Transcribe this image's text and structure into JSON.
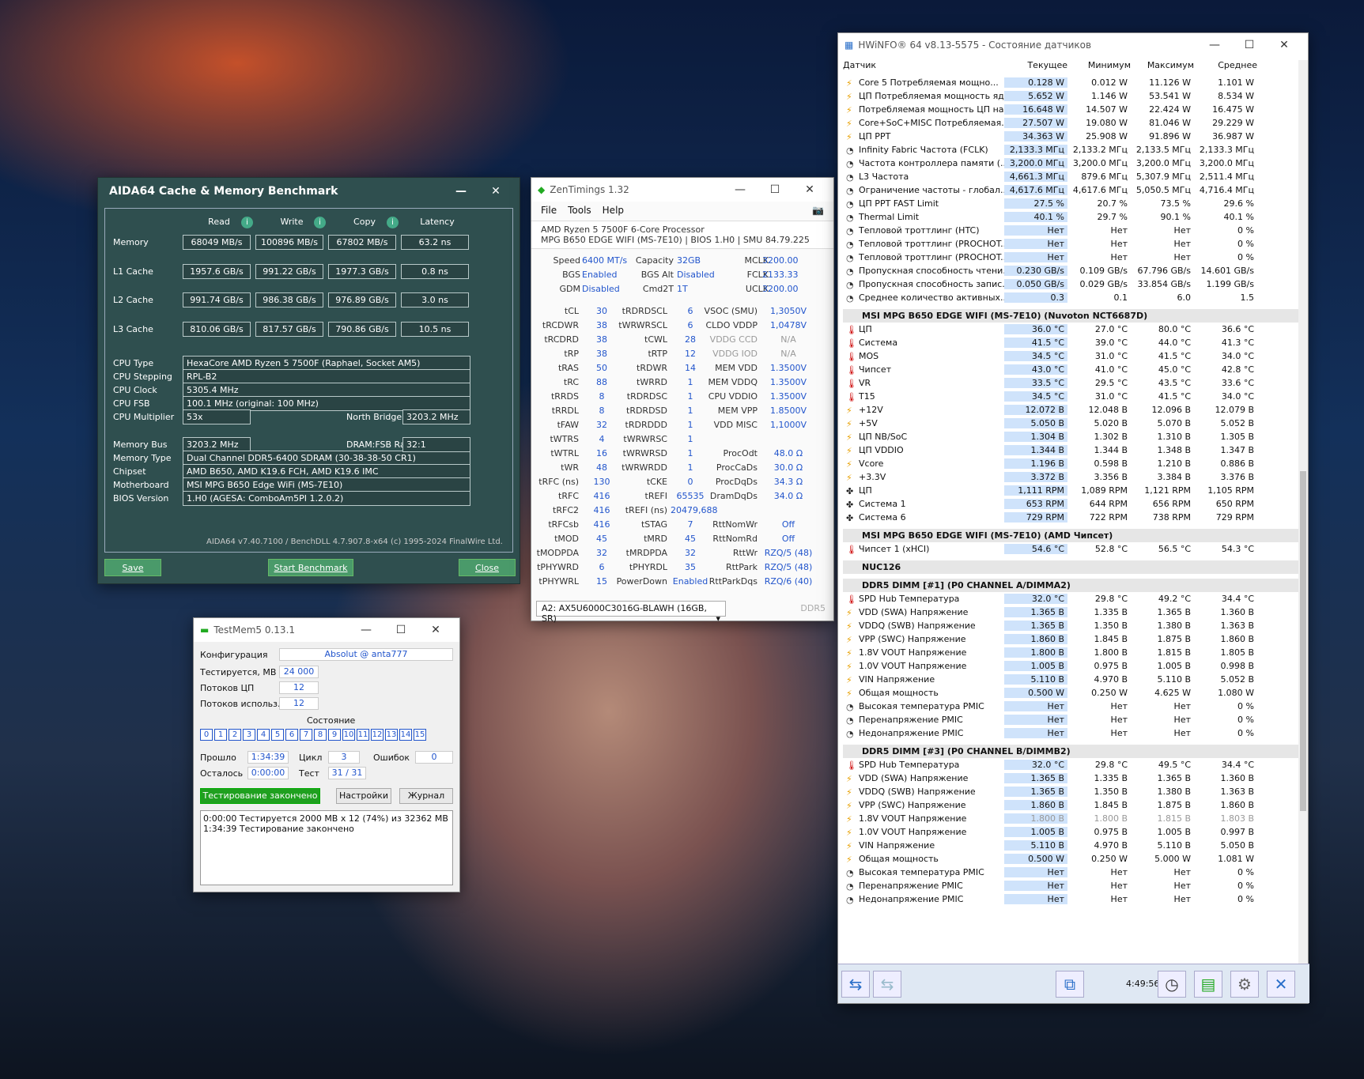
{
  "aida": {
    "title": "AIDA64 Cache & Memory Benchmark",
    "headers": [
      "Read",
      "Write",
      "Copy",
      "Latency"
    ],
    "bench": [
      {
        "label": "Memory",
        "vals": [
          "68049 MB/s",
          "100896 MB/s",
          "67802 MB/s",
          "63.2 ns"
        ]
      },
      {
        "label": "L1 Cache",
        "vals": [
          "1957.6 GB/s",
          "991.22 GB/s",
          "1977.3 GB/s",
          "0.8 ns"
        ]
      },
      {
        "label": "L2 Cache",
        "vals": [
          "991.74 GB/s",
          "986.38 GB/s",
          "976.89 GB/s",
          "3.0 ns"
        ]
      },
      {
        "label": "L3 Cache",
        "vals": [
          "810.06 GB/s",
          "817.57 GB/s",
          "790.86 GB/s",
          "10.5 ns"
        ]
      }
    ],
    "cpu_type_l": "CPU Type",
    "cpu_type": "HexaCore AMD Ryzen 5 7500F  (Raphael, Socket AM5)",
    "cpu_step_l": "CPU Stepping",
    "cpu_step": "RPL-B2",
    "cpu_clock_l": "CPU Clock",
    "cpu_clock": "5305.4 MHz",
    "cpu_fsb_l": "CPU FSB",
    "cpu_fsb": "100.1 MHz  (original: 100 MHz)",
    "cpu_mult_l": "CPU Multiplier",
    "cpu_mult": "53x",
    "nb_l": "North Bridge Clock",
    "nb": "3203.2 MHz",
    "membus_l": "Memory Bus",
    "membus": "3203.2 MHz",
    "ratio_l": "DRAM:FSB Ratio",
    "ratio": "32:1",
    "memtype_l": "Memory Type",
    "memtype": "Dual Channel DDR5-6400 SDRAM  (30-38-38-50 CR1)",
    "chipset_l": "Chipset",
    "chipset": "AMD B650, AMD K19.6 FCH, AMD K19.6 IMC",
    "mb_l": "Motherboard",
    "mb": "MSI MPG B650 Edge WiFi (MS-7E10)",
    "bios_l": "BIOS Version",
    "bios": "1.H0  (AGESA: ComboAm5PI 1.2.0.2)",
    "footer": "AIDA64 v7.40.7100 / BenchDLL 4.7.907.8-x64  (c) 1995-2024 FinalWire Ltd.",
    "save": "Save",
    "start": "Start Benchmark",
    "close": "Close"
  },
  "zen": {
    "title": "ZenTimings 1.32",
    "menu": [
      "File",
      "Tools",
      "Help"
    ],
    "cpu": "AMD Ryzen 5 7500F 6-Core Processor",
    "board": "MPG B650 EDGE WIFI (MS-7E10) | BIOS 1.H0 | SMU 84.79.225",
    "top": [
      [
        "Speed",
        "6400 MT/s",
        "Capacity",
        "32GB",
        "MCLK",
        "3200.00"
      ],
      [
        "BGS",
        "Enabled",
        "BGS Alt",
        "Disabled",
        "FCLK",
        "2133.33"
      ],
      [
        "GDM",
        "Disabled",
        "Cmd2T",
        "1T",
        "UCLK",
        "3200.00"
      ]
    ],
    "rows": [
      [
        "tCL",
        "30",
        "tRDRDSCL",
        "6",
        "VSOC (SMU)",
        "1,3050V"
      ],
      [
        "tRCDWR",
        "38",
        "tWRWRSCL",
        "6",
        "CLDO VDDP",
        "1,0478V"
      ],
      [
        "tRCDRD",
        "38",
        "tCWL",
        "28",
        "VDDG CCD",
        "N/A"
      ],
      [
        "tRP",
        "38",
        "tRTP",
        "12",
        "VDDG IOD",
        "N/A"
      ],
      [
        "tRAS",
        "50",
        "tRDWR",
        "14",
        "MEM VDD",
        "1.3500V"
      ],
      [
        "tRC",
        "88",
        "tWRRD",
        "1",
        "MEM VDDQ",
        "1.3500V"
      ],
      [
        "tRRDS",
        "8",
        "tRDRDSC",
        "1",
        "CPU VDDIO",
        "1.3500V"
      ],
      [
        "tRRDL",
        "8",
        "tRDRDSD",
        "1",
        "MEM VPP",
        "1.8500V"
      ],
      [
        "tFAW",
        "32",
        "tRDRDDD",
        "1",
        "VDD MISC",
        "1,1000V"
      ],
      [
        "tWTRS",
        "4",
        "tWRWRSC",
        "1",
        "",
        ""
      ],
      [
        "tWTRL",
        "16",
        "tWRWRSD",
        "1",
        "ProcOdt",
        "48.0 Ω"
      ],
      [
        "tWR",
        "48",
        "tWRWRDD",
        "1",
        "ProcCaDs",
        "30.0 Ω"
      ],
      [
        "tRFC (ns)",
        "130",
        "tCKE",
        "0",
        "ProcDqDs",
        "34.3 Ω"
      ],
      [
        "tRFC",
        "416",
        "tREFI",
        "65535",
        "DramDqDs",
        "34.0 Ω"
      ],
      [
        "tRFC2",
        "416",
        "tREFI (ns)",
        "20479,688",
        "",
        ""
      ],
      [
        "tRFCsb",
        "416",
        "tSTAG",
        "7",
        "RttNomWr",
        "Off"
      ],
      [
        "tMOD",
        "45",
        "tMRD",
        "45",
        "RttNomRd",
        "Off"
      ],
      [
        "tMODPDA",
        "32",
        "tMRDPDA",
        "32",
        "RttWr",
        "RZQ/5 (48)"
      ],
      [
        "tPHYWRD",
        "6",
        "tPHYRDL",
        "35",
        "RttPark",
        "RZQ/5 (48)"
      ],
      [
        "tPHYWRL",
        "15",
        "PowerDown",
        "Enabled",
        "RttParkDqs",
        "RZQ/6 (40)"
      ]
    ],
    "dimm": "A2: AX5U6000C3016G-BLAWH (16GB, SR)",
    "ddr": "DDR5"
  },
  "tm": {
    "title": "TestMem5  0.13.1",
    "conf_l": "Конфигурация",
    "conf": "Absolut @ anta777",
    "test_l": "Тестируется, МВ",
    "test": "24 000",
    "thr_l": "Потоков ЦП",
    "thr": "12",
    "use_l": "Потоков использ.",
    "use": "12",
    "state": "Состояние",
    "cells": [
      "0",
      "1",
      "2",
      "3",
      "4",
      "5",
      "6",
      "7",
      "8",
      "9",
      "10",
      "11",
      "12",
      "13",
      "14",
      "15"
    ],
    "passed_l": "Прошло",
    "passed": "1:34:39",
    "cyc_l": "Цикл",
    "cyc": "3",
    "err_l": "Ошибок",
    "err": "0",
    "left_l": "Осталось",
    "left": "0:00:00",
    "tst_l": "Тест",
    "tst": "31 / 31",
    "done": "Тестирование закончено",
    "settings": "Настройки",
    "log": "Журнал",
    "log1": "0:00:00  Тестируется 2000 МВ х 12 (74%) из 32362 МВ",
    "log2": "1:34:39  Тестирование закончено"
  },
  "hw": {
    "title": "HWiNFO® 64 v8.13-5575 - Состояние датчиков",
    "cols": [
      "Датчик",
      "Текущее",
      "Минимум",
      "Максимум",
      "Среднее"
    ],
    "time": "4:49:56",
    "rows": [
      [
        "Core 5 Потребляемая мощно...",
        "0.128 W",
        "0.012 W",
        "11.126 W",
        "1.101 W",
        "p"
      ],
      [
        "ЦП Потребляемая мощность яд...",
        "5.652 W",
        "1.146 W",
        "53.541 W",
        "8.534 W",
        "p"
      ],
      [
        "Потребляемая мощность ЦП на...",
        "16.648 W",
        "14.507 W",
        "22.424 W",
        "16.475 W",
        "p"
      ],
      [
        "Core+SoC+MISC Потребляемая...",
        "27.507 W",
        "19.080 W",
        "81.046 W",
        "29.229 W",
        "p"
      ],
      [
        "ЦП PPT",
        "34.363 W",
        "25.908 W",
        "91.896 W",
        "36.987 W",
        "p"
      ],
      [
        "Infinity Fabric Частота (FCLK)",
        "2,133.3 МГц",
        "2,133.2 МГц",
        "2,133.5 МГц",
        "2,133.3 МГц",
        "c"
      ],
      [
        "Частота контроллера памяти (...",
        "3,200.0 МГц",
        "3,200.0 МГц",
        "3,200.0 МГц",
        "3,200.0 МГц",
        "c"
      ],
      [
        "L3 Частота",
        "4,661.3 МГц",
        "879.6 МГц",
        "5,307.9 МГц",
        "2,511.4 МГц",
        "c"
      ],
      [
        "Ограничение частоты - глобал...",
        "4,617.6 МГц",
        "4,617.6 МГц",
        "5,050.5 МГц",
        "4,716.4 МГц",
        "c"
      ],
      [
        "ЦП PPT FAST Limit",
        "27.5 %",
        "20.7 %",
        "73.5 %",
        "29.6 %",
        "c"
      ],
      [
        "Thermal Limit",
        "40.1 %",
        "29.7 %",
        "90.1 %",
        "40.1 %",
        "c"
      ],
      [
        "Тепловой троттлинг (HTC)",
        "Нет",
        "Нет",
        "Нет",
        "0 %",
        "c"
      ],
      [
        "Тепловой троттлинг (PROCHOT...",
        "Нет",
        "Нет",
        "Нет",
        "0 %",
        "c"
      ],
      [
        "Тепловой троттлинг (PROCHOT...",
        "Нет",
        "Нет",
        "Нет",
        "0 %",
        "c"
      ],
      [
        "Пропускная способность чтени...",
        "0.230 GB/s",
        "0.109 GB/s",
        "67.796 GB/s",
        "14.601 GB/s",
        "c"
      ],
      [
        "Пропускная способность запис...",
        "0.050 GB/s",
        "0.029 GB/s",
        "33.854 GB/s",
        "1.199 GB/s",
        "c"
      ],
      [
        "Среднее количество активных...",
        "0.3",
        "0.1",
        "6.0",
        "1.5",
        "c"
      ],
      [
        "S",
        "MSI MPG B650 EDGE WIFI (MS-7E10) (Nuvoton NCT6687D)"
      ],
      [
        "ЦП",
        "36.0 °C",
        "27.0 °C",
        "80.0 °C",
        "36.6 °C",
        "t"
      ],
      [
        "Система",
        "41.5 °C",
        "39.0 °C",
        "44.0 °C",
        "41.3 °C",
        "t"
      ],
      [
        "MOS",
        "34.5 °C",
        "31.0 °C",
        "41.5 °C",
        "34.0 °C",
        "t"
      ],
      [
        "Чипсет",
        "43.0 °C",
        "41.0 °C",
        "45.0 °C",
        "42.8 °C",
        "t"
      ],
      [
        "VR",
        "33.5 °C",
        "29.5 °C",
        "43.5 °C",
        "33.6 °C",
        "t"
      ],
      [
        "T15",
        "34.5 °C",
        "31.0 °C",
        "41.5 °C",
        "34.0 °C",
        "t"
      ],
      [
        "+12V",
        "12.072 В",
        "12.048 В",
        "12.096 В",
        "12.079 В",
        "p"
      ],
      [
        "+5V",
        "5.050 В",
        "5.020 В",
        "5.070 В",
        "5.052 В",
        "p"
      ],
      [
        "ЦП NB/SoC",
        "1.304 В",
        "1.302 В",
        "1.310 В",
        "1.305 В",
        "p"
      ],
      [
        "ЦП VDDIO",
        "1.344 В",
        "1.344 В",
        "1.348 В",
        "1.347 В",
        "p"
      ],
      [
        "Vcore",
        "1.196 В",
        "0.598 В",
        "1.210 В",
        "0.886 В",
        "p"
      ],
      [
        "+3.3V",
        "3.372 В",
        "3.356 В",
        "3.384 В",
        "3.376 В",
        "p"
      ],
      [
        "ЦП",
        "1,111 RPM",
        "1,089 RPM",
        "1,121 RPM",
        "1,105 RPM",
        "f"
      ],
      [
        "Система 1",
        "653 RPM",
        "644 RPM",
        "656 RPM",
        "650 RPM",
        "f"
      ],
      [
        "Система 6",
        "729 RPM",
        "722 RPM",
        "738 RPM",
        "729 RPM",
        "f"
      ],
      [
        "S",
        "MSI MPG B650 EDGE WIFI (MS-7E10) (AMD Чипсет)"
      ],
      [
        "Чипсет 1 (xHCI)",
        "54.6 °C",
        "52.8 °C",
        "56.5 °C",
        "54.3 °C",
        "t"
      ],
      [
        "S",
        "NUC126"
      ],
      [
        "S",
        "DDR5 DIMM [#1] (P0 CHANNEL A/DIMMA2)"
      ],
      [
        "SPD Hub Температура",
        "32.0 °C",
        "29.8 °C",
        "49.2 °C",
        "34.4 °C",
        "t"
      ],
      [
        "VDD (SWA) Напряжение",
        "1.365 В",
        "1.335 В",
        "1.365 В",
        "1.360 В",
        "p"
      ],
      [
        "VDDQ (SWB) Напряжение",
        "1.365 В",
        "1.350 В",
        "1.380 В",
        "1.363 В",
        "p"
      ],
      [
        "VPP (SWC) Напряжение",
        "1.860 В",
        "1.845 В",
        "1.875 В",
        "1.860 В",
        "p"
      ],
      [
        "1.8V VOUT Напряжение",
        "1.800 В",
        "1.800 В",
        "1.815 В",
        "1.805 В",
        "p"
      ],
      [
        "1.0V VOUT Напряжение",
        "1.005 В",
        "0.975 В",
        "1.005 В",
        "0.998 В",
        "p"
      ],
      [
        "VIN Напряжение",
        "5.110 В",
        "4.970 В",
        "5.110 В",
        "5.052 В",
        "p"
      ],
      [
        "Общая мощность",
        "0.500 W",
        "0.250 W",
        "4.625 W",
        "1.080 W",
        "p"
      ],
      [
        "Высокая температура PMIC",
        "Нет",
        "Нет",
        "Нет",
        "0 %",
        "c"
      ],
      [
        "Перенапряжение PMIC",
        "Нет",
        "Нет",
        "Нет",
        "0 %",
        "c"
      ],
      [
        "Недонапряжение PMIC",
        "Нет",
        "Нет",
        "Нет",
        "0 %",
        "c"
      ],
      [
        "S",
        "DDR5 DIMM [#3] (P0 CHANNEL B/DIMMB2)"
      ],
      [
        "SPD Hub Температура",
        "32.0 °C",
        "29.8 °C",
        "49.5 °C",
        "34.4 °C",
        "t"
      ],
      [
        "VDD (SWA) Напряжение",
        "1.365 В",
        "1.335 В",
        "1.365 В",
        "1.360 В",
        "p"
      ],
      [
        "VDDQ (SWB) Напряжение",
        "1.365 В",
        "1.350 В",
        "1.380 В",
        "1.363 В",
        "p"
      ],
      [
        "VPP (SWC) Напряжение",
        "1.860 В",
        "1.845 В",
        "1.875 В",
        "1.860 В",
        "p"
      ],
      [
        "1.8V VOUT Напряжение",
        "1.800 В",
        "1.800 В",
        "1.815 В",
        "1.803 В",
        "p"
      ],
      [
        "1.0V VOUT Напряжение",
        "1.005 В",
        "0.975 В",
        "1.005 В",
        "0.997 В",
        "p"
      ],
      [
        "VIN Напряжение",
        "5.110 В",
        "4.970 В",
        "5.110 В",
        "5.050 В",
        "p"
      ],
      [
        "Общая мощность",
        "0.500 W",
        "0.250 W",
        "5.000 W",
        "1.081 W",
        "p"
      ],
      [
        "Высокая температура PMIC",
        "Нет",
        "Нет",
        "Нет",
        "0 %",
        "c"
      ],
      [
        "Перенапряжение PMIC",
        "Нет",
        "Нет",
        "Нет",
        "0 %",
        "c"
      ],
      [
        "Недонапряжение PMIC",
        "Нет",
        "Нет",
        "Нет",
        "0 %",
        "c"
      ]
    ]
  }
}
